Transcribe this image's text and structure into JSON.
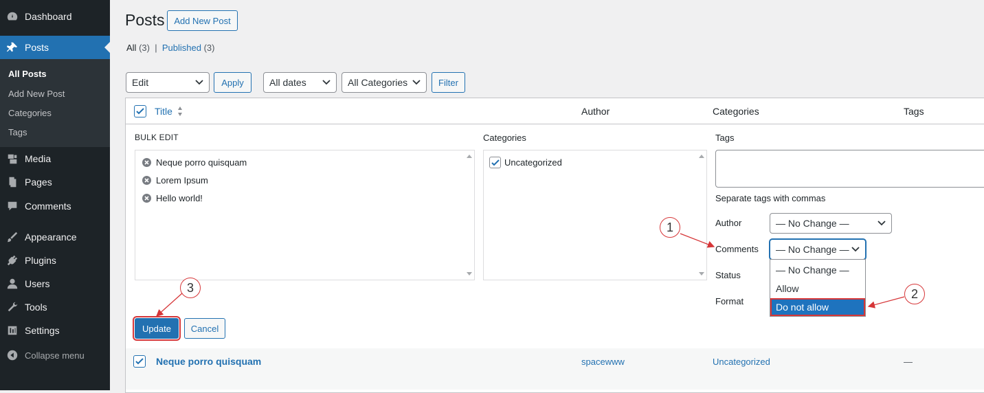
{
  "sidebar": {
    "items": [
      {
        "label": "Dashboard",
        "icon": "dashboard-icon"
      },
      {
        "label": "Posts",
        "icon": "pin-icon"
      },
      {
        "label": "Media",
        "icon": "media-icon"
      },
      {
        "label": "Pages",
        "icon": "pages-icon"
      },
      {
        "label": "Comments",
        "icon": "comments-icon"
      },
      {
        "label": "Appearance",
        "icon": "appearance-icon"
      },
      {
        "label": "Plugins",
        "icon": "plugins-icon"
      },
      {
        "label": "Users",
        "icon": "users-icon"
      },
      {
        "label": "Tools",
        "icon": "tools-icon"
      },
      {
        "label": "Settings",
        "icon": "settings-icon"
      }
    ],
    "submenu": [
      "All Posts",
      "Add New Post",
      "Categories",
      "Tags"
    ],
    "collapse": "Collapse menu"
  },
  "header": {
    "title": "Posts",
    "add_new": "Add New Post",
    "filters": {
      "all": "All",
      "all_count": "(3)",
      "separator": "|",
      "published": "Published",
      "published_count": "(3)"
    }
  },
  "toolbar": {
    "bulk_action": "Edit",
    "apply": "Apply",
    "dates": "All dates",
    "categories": "All Categories",
    "filter": "Filter"
  },
  "table": {
    "columns": {
      "title": "Title",
      "author": "Author",
      "categories": "Categories",
      "tags": "Tags"
    },
    "row": {
      "title": "Neque porro quisquam",
      "author": "spacewww",
      "categories": "Uncategorized",
      "tags": "—"
    }
  },
  "bulk_edit": {
    "heading": "BULK EDIT",
    "posts": [
      "Neque porro quisquam",
      "Lorem Ipsum",
      "Hello world!"
    ],
    "categories_label": "Categories",
    "category_item": "Uncategorized",
    "tags_label": "Tags",
    "tags_help": "Separate tags with commas",
    "author_label": "Author",
    "author_value": "— No Change —",
    "comments_label": "Comments",
    "comments_value": "— No Change —",
    "status_label": "Status",
    "format_label": "Format",
    "comments_options": [
      "— No Change —",
      "Allow",
      "Do not allow"
    ],
    "update": "Update",
    "cancel": "Cancel"
  },
  "annotations": [
    "1",
    "2",
    "3"
  ],
  "colors": {
    "accent": "#2271b1",
    "sidebar_bg": "#1d2327",
    "annotation": "#d63638"
  }
}
